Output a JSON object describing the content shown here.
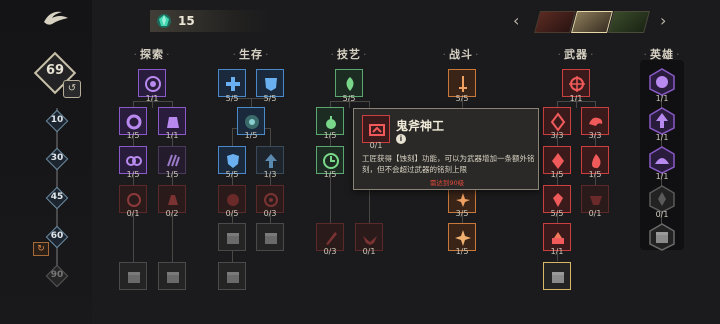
{
  "sidebar": {
    "level": "69",
    "milestones": [
      "10",
      "30",
      "45",
      "60",
      "90"
    ],
    "reset_glyph": "↺",
    "marker_glyph": "↻"
  },
  "currency": {
    "amount": "15",
    "icon": "gem-icon",
    "color": "#3fd6b0"
  },
  "characters": {
    "prev": "‹",
    "next": "›"
  },
  "columns": [
    {
      "title": "探索"
    },
    {
      "title": "生存"
    },
    {
      "title": "技艺"
    },
    {
      "title": "战斗"
    },
    {
      "title": "武器"
    },
    {
      "title": "英雄"
    }
  ],
  "counts": {
    "explore": [
      "1/1",
      "1/5",
      "1/1",
      "1/5",
      "1/5",
      "0/1",
      "0/2"
    ],
    "survive": [
      "5/5",
      "5/5",
      "1/5",
      "5/5",
      "1/3",
      "0/5",
      "0/3"
    ],
    "craft": [
      "5/5",
      "1/5",
      "1/5",
      "0/3",
      "0/1"
    ],
    "combat": [
      "5/5",
      "3/5",
      "1/5"
    ],
    "weapon": [
      "1/1",
      "3/3",
      "3/3",
      "1/5",
      "1/5",
      "5/5",
      "0/1",
      "1/1"
    ],
    "hero": [
      "1/1",
      "1/1",
      "1/1",
      "0/1"
    ]
  },
  "tooltip": {
    "title": "鬼斧神工",
    "count": "0/1",
    "info": "i",
    "description": "工匠获得【蚀刻】功能，可以为武器增加一条额外铭刻，但不会超过武器的铭刻上限",
    "unlock": "需达到90级"
  },
  "colors": {
    "accent_gold": "#d8b868",
    "explore": "#8a5ac8",
    "survive": "#4a8ac8",
    "craft": "#5aa870",
    "combat": "#c8783a",
    "weapon": "#c84040"
  }
}
